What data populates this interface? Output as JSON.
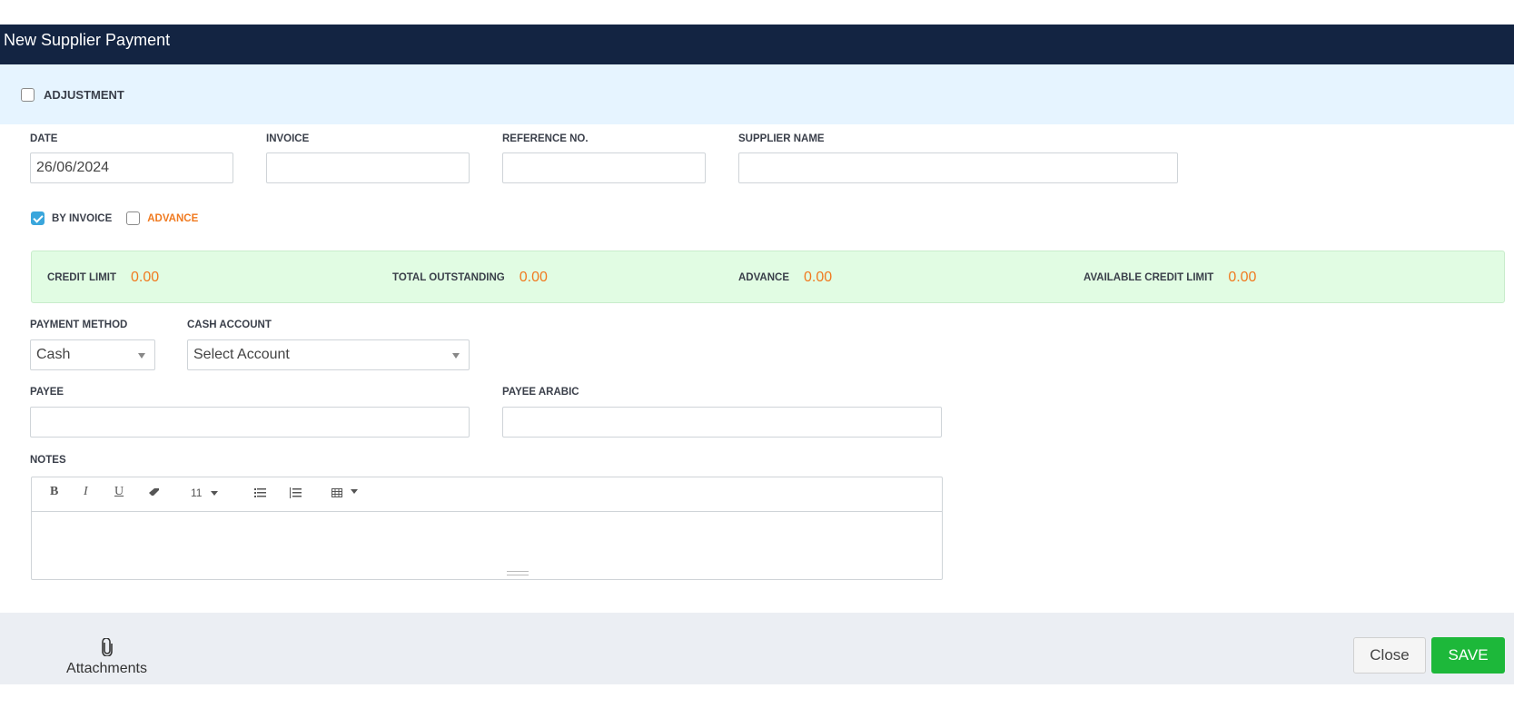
{
  "header": {
    "title": "New Supplier Payment"
  },
  "adjustment": {
    "label": "ADJUSTMENT",
    "checked": false
  },
  "fields": {
    "date": {
      "label": "DATE",
      "value": "26/06/2024"
    },
    "invoice": {
      "label": "INVOICE",
      "value": ""
    },
    "reference": {
      "label": "REFERENCE NO.",
      "value": ""
    },
    "supplier": {
      "label": "SUPPLIER NAME",
      "value": ""
    },
    "payment_method": {
      "label": "PAYMENT METHOD",
      "value": "Cash"
    },
    "cash_account": {
      "label": "CASH ACCOUNT",
      "value": "Select Account"
    },
    "payee": {
      "label": "PAYEE",
      "value": ""
    },
    "payee_arabic": {
      "label": "PAYEE ARABIC",
      "value": ""
    },
    "notes": {
      "label": "NOTES",
      "value": ""
    }
  },
  "payment_type": {
    "by_invoice": {
      "label": "BY INVOICE",
      "checked": true
    },
    "advance": {
      "label": "ADVANCE",
      "checked": false
    }
  },
  "summary": {
    "credit_limit": {
      "label": "CREDIT LIMIT",
      "value": "0.00"
    },
    "total_outstanding": {
      "label": "TOTAL OUTSTANDING",
      "value": "0.00"
    },
    "advance": {
      "label": "ADVANCE",
      "value": "0.00"
    },
    "available_credit_limit": {
      "label": "AVAILABLE CREDIT LIMIT",
      "value": "0.00"
    }
  },
  "editor_toolbar": {
    "bold": "B",
    "italic": "I",
    "underline": "U",
    "eraser": "eraser-icon",
    "font_size": "11",
    "bullet_list": "unordered-list-icon",
    "numbered_list": "ordered-list-icon",
    "table": "table-icon"
  },
  "footer": {
    "attachments_label": "Attachments",
    "close_label": "Close",
    "save_label": "SAVE"
  },
  "colors": {
    "header_bg": "#132442",
    "accent_orange": "#f07a20",
    "save_green": "#1db83a",
    "checkbox_blue": "#3aa6dc",
    "summary_bg": "#e1fce3"
  }
}
